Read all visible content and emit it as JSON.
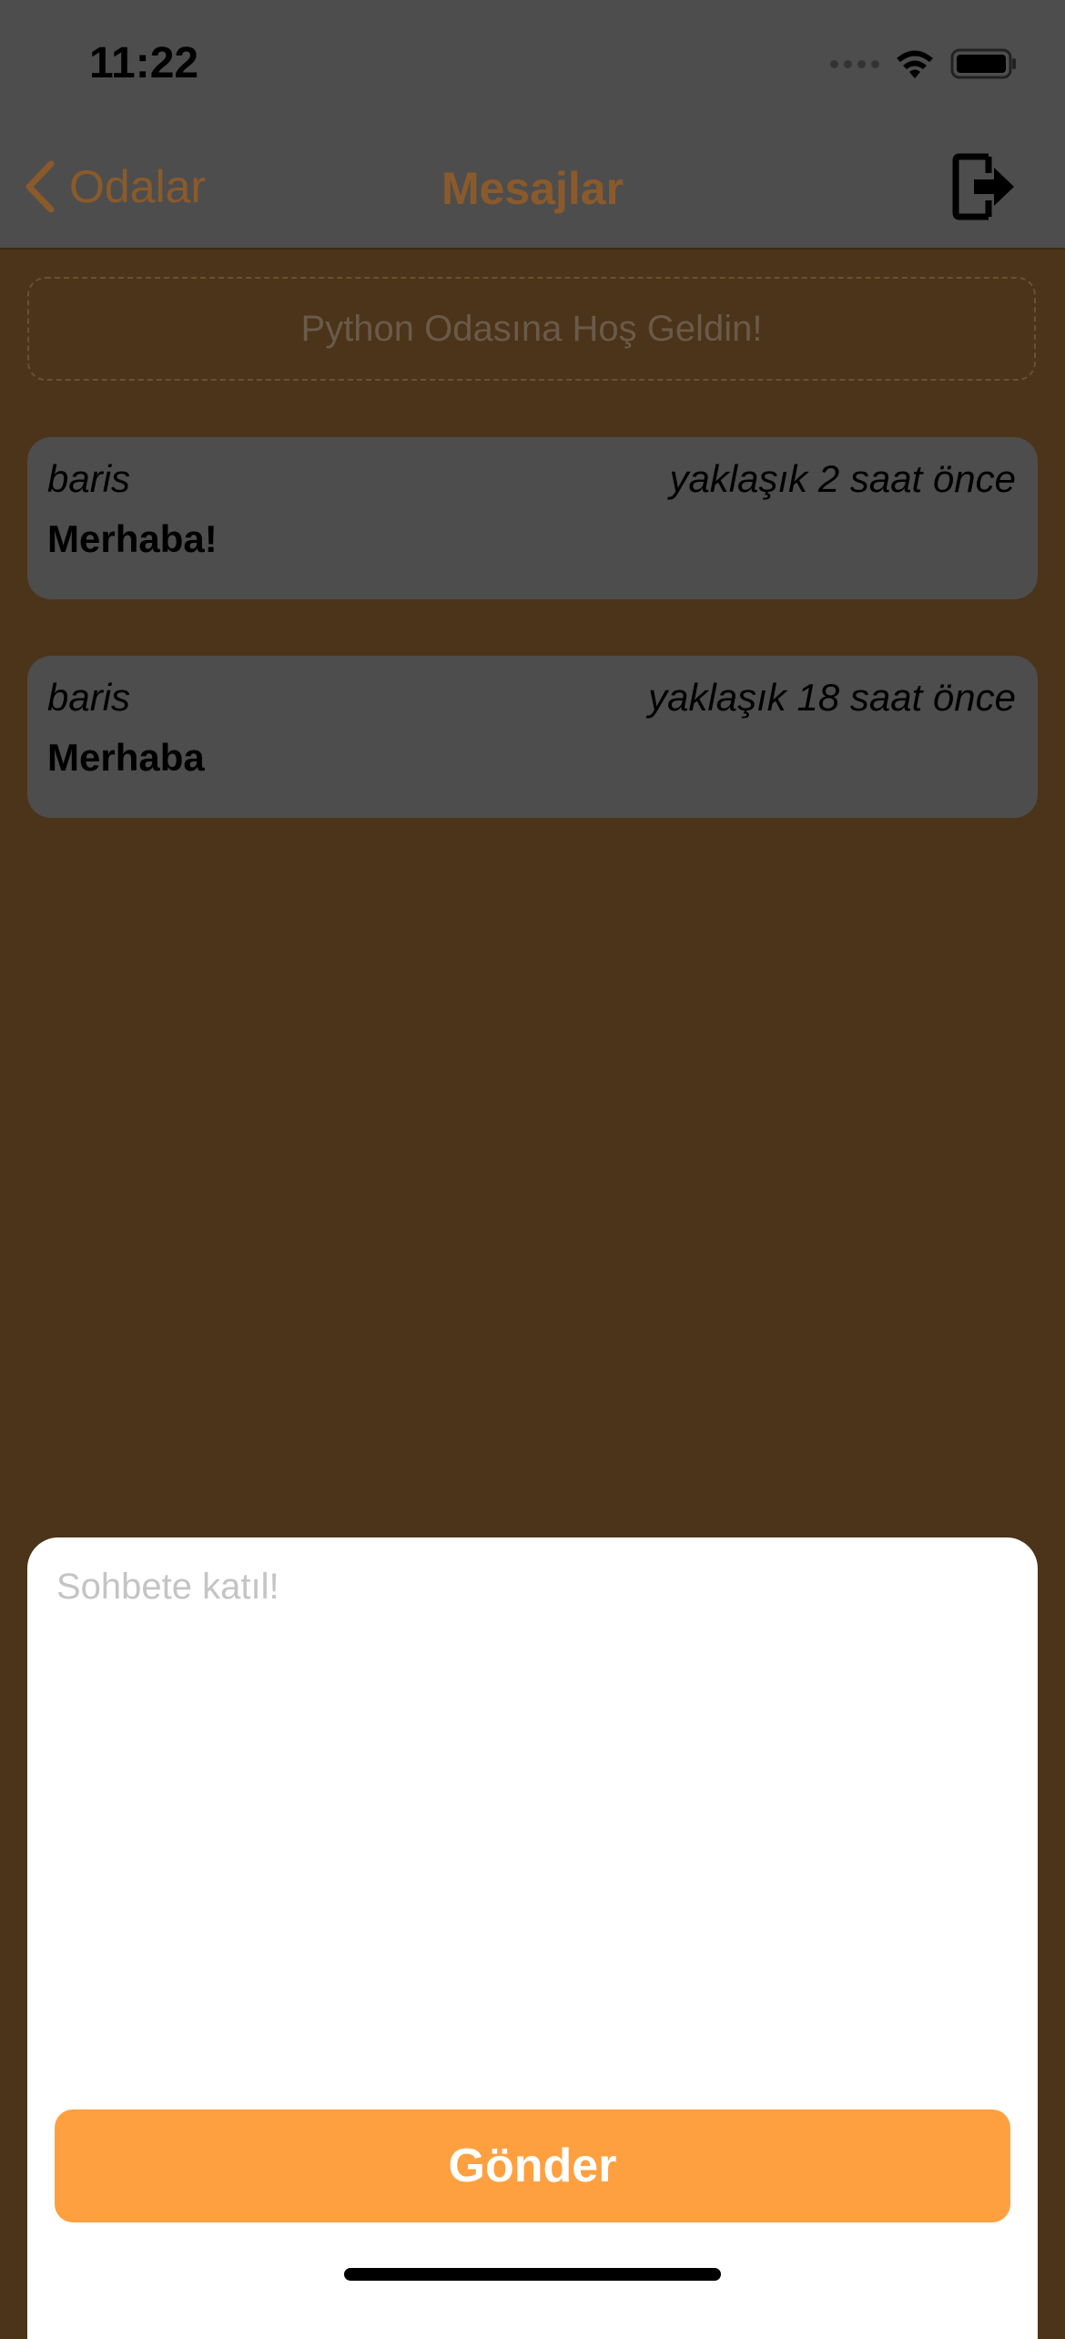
{
  "status_bar": {
    "time": "11:22",
    "icons": [
      "cellular-signal-icon",
      "wifi-icon",
      "battery-icon"
    ]
  },
  "nav": {
    "back_label": "Odalar",
    "title": "Mesajlar",
    "logout_icon": "logout-icon"
  },
  "room": {
    "welcome_text": "Python Odasına Hoş Geldin!"
  },
  "messages": [
    {
      "user": "baris",
      "time": "yaklaşık 2 saat önce",
      "text": "Merhaba!"
    },
    {
      "user": "baris",
      "time": "yaklaşık 18 saat önce",
      "text": "Merhaba"
    }
  ],
  "composer": {
    "placeholder": "Sohbete katıl!",
    "value": "",
    "send_label": "Gönder"
  },
  "colors": {
    "accent": "#ffa040",
    "nav_tint": "#8b5a2b",
    "background_dimmed": "#4b3419",
    "card_dimmed": "#4d4d4d"
  }
}
